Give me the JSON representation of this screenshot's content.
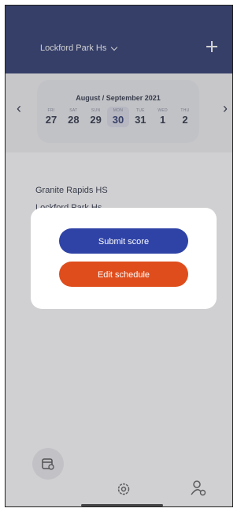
{
  "header": {
    "team_name": "Lockford Park Hs",
    "dropdown_icon": "chevron-down-icon",
    "add_icon": "plus-icon"
  },
  "calendar": {
    "title": "August / September 2021",
    "days": [
      {
        "name": "FRI",
        "date": "27"
      },
      {
        "name": "SAT",
        "date": "28"
      },
      {
        "name": "SUN",
        "date": "29"
      },
      {
        "name": "MON",
        "date": "30"
      },
      {
        "name": "TUE",
        "date": "31"
      },
      {
        "name": "WED",
        "date": "1"
      },
      {
        "name": "THU",
        "date": "2"
      }
    ],
    "selected_index": 3,
    "prev_icon": "chevron-left-icon",
    "next_icon": "chevron-right-icon"
  },
  "game": {
    "team_home": "Granite Rapids HS",
    "team_away": "Lockford Park Hs"
  },
  "modal": {
    "submit_label": "Submit score",
    "edit_label": "Edit schedule"
  },
  "tabbar": {
    "schedule_icon": "calendar-icon",
    "settings_icon": "gear-icon",
    "profile_icon": "user-settings-icon"
  },
  "colors": {
    "header": "#1c2a63",
    "submit_button": "#2f43a6",
    "edit_button": "#df4d1c"
  }
}
